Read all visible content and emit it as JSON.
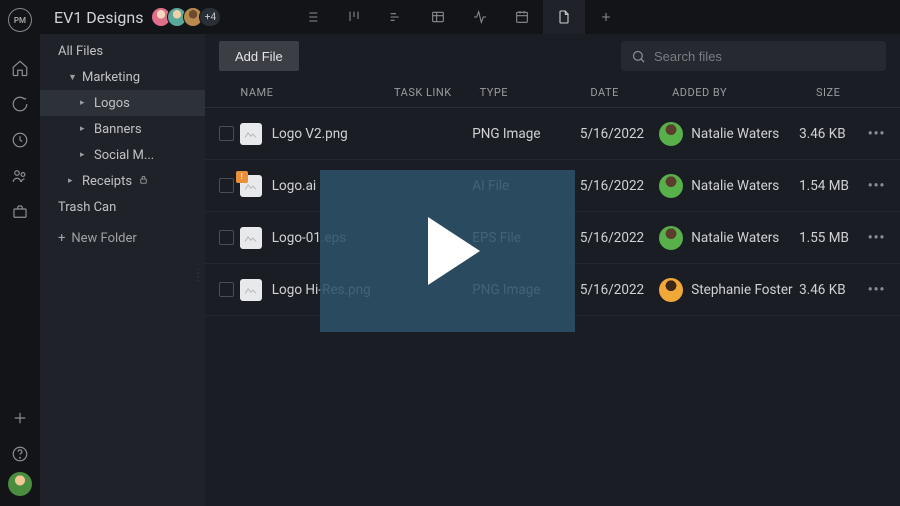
{
  "topbar": {
    "title": "EV1 Designs",
    "avatar_more": "+4",
    "views": [
      {
        "name": "list-view-icon"
      },
      {
        "name": "board-view-icon"
      },
      {
        "name": "gantt-view-icon"
      },
      {
        "name": "sheet-view-icon"
      },
      {
        "name": "dashboard-view-icon"
      },
      {
        "name": "calendar-view-icon"
      },
      {
        "name": "files-view-icon",
        "active": true
      },
      {
        "name": "add-view-icon"
      }
    ]
  },
  "sidebar": {
    "items": [
      {
        "label": "All Files",
        "level": 1
      },
      {
        "label": "Marketing",
        "level": 1,
        "chev": "▼"
      },
      {
        "label": "Logos",
        "level": 2,
        "chev": "▸",
        "selected": true
      },
      {
        "label": "Banners",
        "level": 2,
        "chev": "▸"
      },
      {
        "label": "Social M...",
        "level": 2,
        "chev": "▸"
      },
      {
        "label": "Receipts",
        "level": 1,
        "chev": "▸",
        "locked": true
      },
      {
        "label": "Trash Can",
        "level": 1
      }
    ],
    "new_folder": "New Folder"
  },
  "toolbar": {
    "add_file": "Add File",
    "search_placeholder": "Search files"
  },
  "table": {
    "columns": {
      "name": "NAME",
      "task_link": "TASK LINK",
      "type": "TYPE",
      "date": "DATE",
      "added_by": "ADDED BY",
      "size": "SIZE"
    },
    "rows": [
      {
        "name": "Logo V2.png",
        "task_link": "",
        "type": "PNG Image",
        "date": "5/16/2022",
        "added_by": "Natalie Waters",
        "avatar": "green",
        "size": "3.46 KB",
        "badge": false
      },
      {
        "name": "Logo.ai",
        "task_link": "",
        "type": "AI File",
        "date": "5/16/2022",
        "added_by": "Natalie Waters",
        "avatar": "green",
        "size": "1.54 MB",
        "badge": true
      },
      {
        "name": "Logo-01.eps",
        "task_link": "",
        "type": "EPS File",
        "date": "5/16/2022",
        "added_by": "Natalie Waters",
        "avatar": "green",
        "size": "1.55 MB",
        "badge": false
      },
      {
        "name": "Logo Hi-Res.png",
        "task_link": "",
        "type": "PNG Image",
        "date": "5/16/2022",
        "added_by": "Stephanie Foster",
        "avatar": "orange",
        "size": "3.46 KB",
        "badge": false
      }
    ]
  }
}
